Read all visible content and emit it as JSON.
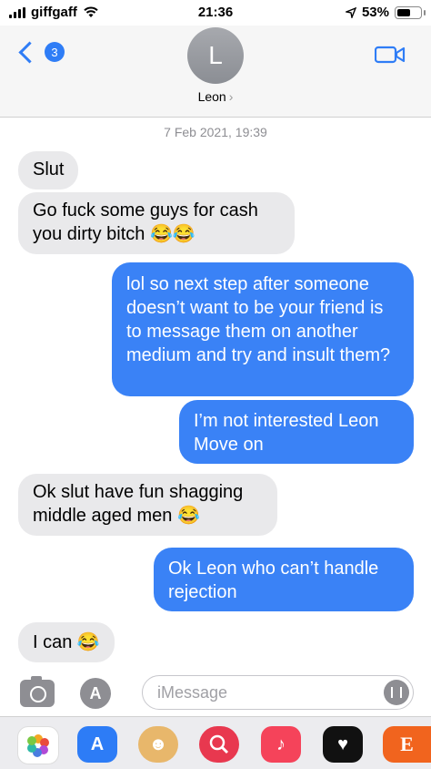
{
  "status_bar": {
    "carrier": "giffgaff",
    "time": "21:36",
    "battery": "53%"
  },
  "header": {
    "back_count": "3",
    "avatar_initial": "L",
    "contact_name": "Leon",
    "chevron": "›"
  },
  "conversation": {
    "timestamp": "7 Feb 2021, 19:39",
    "messages": [
      {
        "direction": "in",
        "text": "Slut"
      },
      {
        "direction": "in",
        "text": "Go fuck some guys for cash you dirty bitch 😂😂"
      },
      {
        "direction": "out",
        "text": "lol so next step after someone doesn’t want to be your friend is to message them on another medium and try and insult them?"
      },
      {
        "direction": "out",
        "text": "I’m not interested Leon Move on"
      },
      {
        "direction": "in",
        "text": "Ok slut have fun shagging middle aged men 😂"
      },
      {
        "direction": "out",
        "text": "Ok Leon who can’t handle rejection"
      },
      {
        "direction": "in",
        "text": "I can 😂"
      }
    ]
  },
  "input": {
    "placeholder": "iMessage"
  },
  "app_drawer": {
    "apps": [
      "photos-icon",
      "app-store-icon",
      "memoji-icon",
      "search-images-icon",
      "music-icon",
      "digital-touch-icon",
      "etsy-icon"
    ],
    "etsy_label": "E"
  },
  "colors": {
    "outgoing_bubble": "#3a82f6",
    "incoming_bubble": "#e9e9eb",
    "accent": "#2f7df6"
  }
}
